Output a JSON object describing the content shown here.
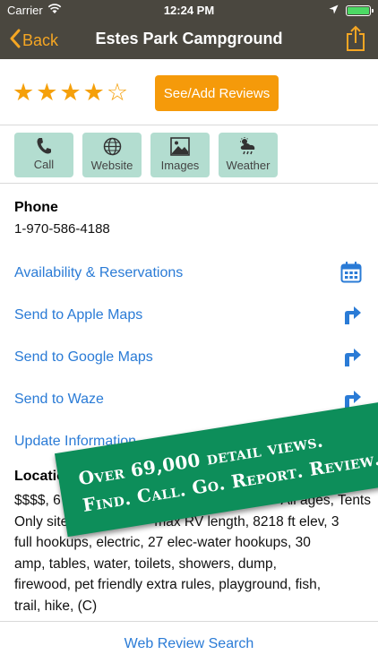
{
  "status_bar": {
    "carrier": "Carrier",
    "time": "12:24 PM"
  },
  "nav": {
    "back_label": "Back",
    "title": "Estes Park Campground"
  },
  "rating": {
    "filled_stars": 4,
    "total_stars": 5,
    "button_label": "See/Add Reviews"
  },
  "actions": [
    {
      "label": "Call",
      "icon": "phone-icon"
    },
    {
      "label": "Website",
      "icon": "globe-icon"
    },
    {
      "label": "Images",
      "icon": "image-icon"
    },
    {
      "label": "Weather",
      "icon": "weather-icon"
    }
  ],
  "phone": {
    "heading": "Phone",
    "number": "1-970-586-4188"
  },
  "links": {
    "availability": "Availability & Reservations",
    "apple_maps": "Send to Apple Maps",
    "google_maps": "Send to Google Maps",
    "waze": "Send to Waze",
    "update": "Update Information"
  },
  "location": {
    "heading": "Location",
    "body": "$$$$, 6… max RV length, 8218 ft elev, 3 full hookups, electric, 27 elec-water hookups, 30 amp, tables, water, toilets, showers, dump, firewood, pet friendly extra rules, playground, fish, trail, hike, (C)",
    "line1_right": "All ages, Tents",
    "line2_left": "Only site"
  },
  "web_review_search": "Web Review Search",
  "banner": {
    "line1": "Over 69,000 detail views.",
    "line2": "Find. Call. Go. Report. Review."
  },
  "colors": {
    "nav_bg": "#4a473f",
    "accent_orange": "#f59a0a",
    "action_bg": "#b3ddd0",
    "link_blue": "#2a7bd6",
    "banner_green": "#0d8e5a"
  }
}
